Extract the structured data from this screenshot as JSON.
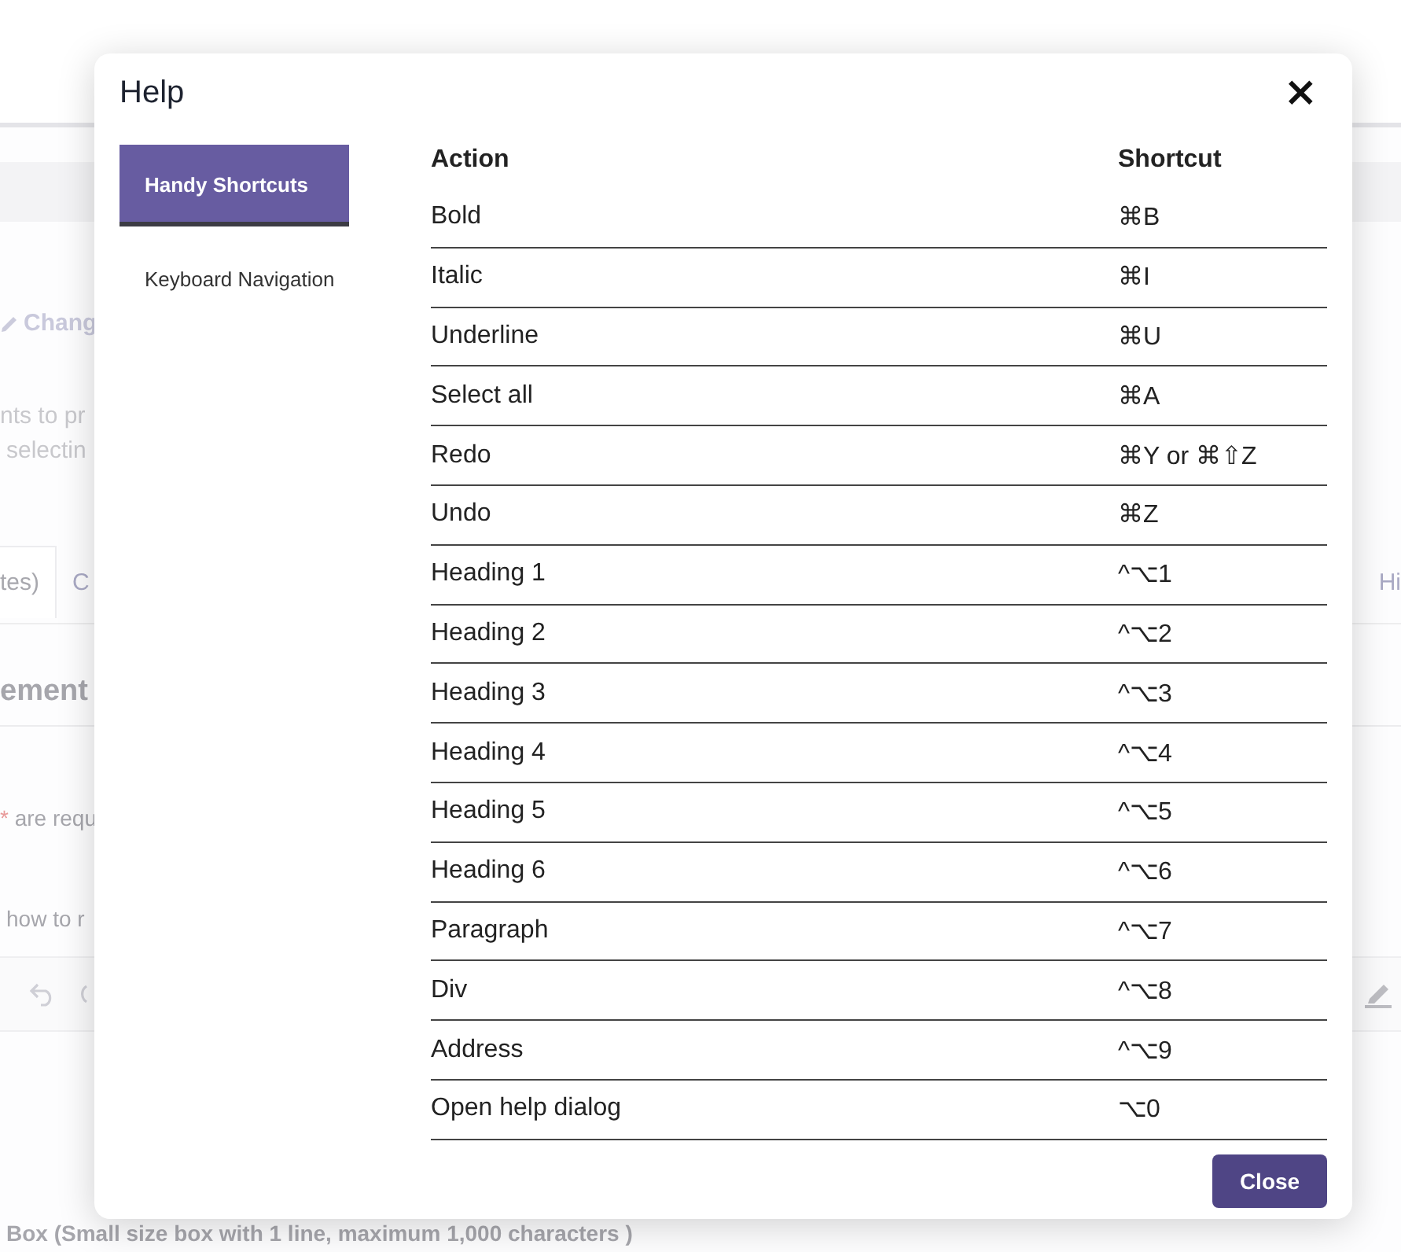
{
  "background": {
    "edit_link": "Chang",
    "intro_lines": [
      "nts to pr",
      "selectin"
    ],
    "tabs": [
      {
        "label": "tes)",
        "selected": true
      },
      {
        "label": "C",
        "selected": false
      },
      {
        "label": "Hi",
        "selected": false
      }
    ],
    "section_heading": "ement",
    "required_note": {
      "mark": "*",
      "text": "are requ"
    },
    "help_line": "how to r",
    "field_label": "Box (Small size box with 1 line, maximum 1,000 characters )"
  },
  "dialog": {
    "title": "Help",
    "close_icon": "×",
    "tabs": [
      {
        "label": "Handy Shortcuts",
        "selected": true
      },
      {
        "label": "Keyboard Navigation",
        "selected": false
      }
    ],
    "table": {
      "columns": [
        "Action",
        "Shortcut"
      ],
      "rows": [
        {
          "action": "Bold",
          "shortcut": "⌘B"
        },
        {
          "action": "Italic",
          "shortcut": "⌘I"
        },
        {
          "action": "Underline",
          "shortcut": "⌘U"
        },
        {
          "action": "Select all",
          "shortcut": "⌘A"
        },
        {
          "action": "Redo",
          "shortcut": "⌘Y or ⌘⇧Z"
        },
        {
          "action": "Undo",
          "shortcut": "⌘Z"
        },
        {
          "action": "Heading 1",
          "shortcut": "^⌥1"
        },
        {
          "action": "Heading 2",
          "shortcut": "^⌥2"
        },
        {
          "action": "Heading 3",
          "shortcut": "^⌥3"
        },
        {
          "action": "Heading 4",
          "shortcut": "^⌥4"
        },
        {
          "action": "Heading 5",
          "shortcut": "^⌥5"
        },
        {
          "action": "Heading 6",
          "shortcut": "^⌥6"
        },
        {
          "action": "Paragraph",
          "shortcut": "^⌥7"
        },
        {
          "action": "Div",
          "shortcut": "^⌥8"
        },
        {
          "action": "Address",
          "shortcut": "^⌥9"
        },
        {
          "action": "Open help dialog",
          "shortcut": "⌥0"
        }
      ]
    },
    "close_button": "Close"
  }
}
